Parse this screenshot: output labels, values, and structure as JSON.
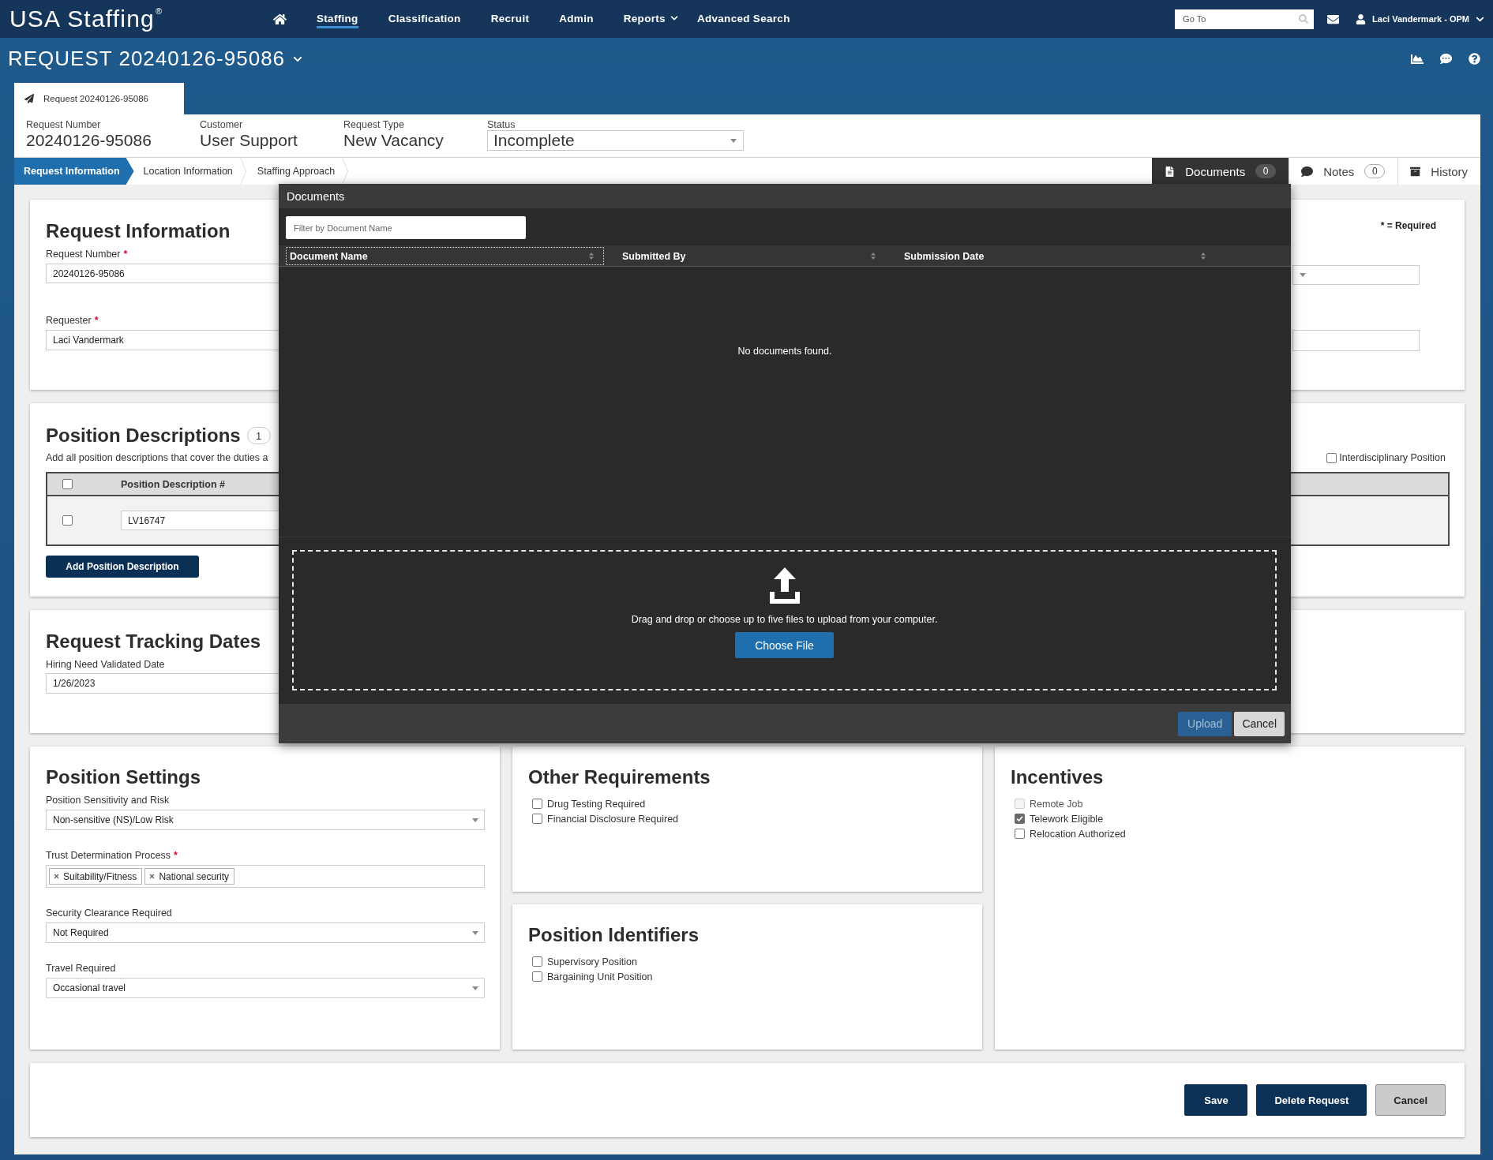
{
  "top_nav": {
    "logo": "USA Staffing$^{®}$",
    "items": [
      {
        "label": "Staffing",
        "selected": true,
        "has_menu": false
      },
      {
        "label": "Classification",
        "selected": false,
        "has_menu": false
      },
      {
        "label": "Recruit",
        "selected": false,
        "has_menu": false
      },
      {
        "label": "Admin",
        "selected": false,
        "has_menu": false
      },
      {
        "label": "Reports",
        "selected": false,
        "has_menu": true
      },
      {
        "label": "Advanced Search",
        "selected": false,
        "has_menu": false
      }
    ],
    "go_to": {
      "placeholder": "Go To"
    },
    "user": "Laci Vandermark - OPM"
  },
  "title_bar": {
    "title": "REQUEST 20240126-95086"
  },
  "record_tab": {
    "label": "Request 20240126-95086"
  },
  "summary": [
    {
      "label": "Request Number",
      "value": "20240126-95086",
      "kind": "text"
    },
    {
      "label": "Customer",
      "value": "User Support",
      "kind": "text"
    },
    {
      "label": "Request Type",
      "value": "New Vacancy",
      "kind": "text"
    },
    {
      "label": "Status",
      "value": "Incomplete",
      "kind": "select"
    }
  ],
  "steps": [
    {
      "label": "Request Information",
      "selected": true
    },
    {
      "label": "Location Information",
      "selected": false
    },
    {
      "label": "Staffing Approach",
      "selected": false
    }
  ],
  "side_tabs": [
    {
      "label": "Documents",
      "count": "0",
      "selected": true
    },
    {
      "label": "Notes",
      "count": "0",
      "selected": false
    },
    {
      "label": "History",
      "selected": false
    }
  ],
  "request_information": {
    "title": "Request Information",
    "required_note": "* = Required",
    "fields": [
      {
        "label": "Request Number",
        "required_mark": "*",
        "value": "20240126-95086"
      },
      {
        "label": "Requester",
        "required_mark": "*",
        "value": "Laci Vandermark"
      }
    ],
    "right_fields": [
      {
        "kind": "select"
      },
      {
        "kind": "text"
      }
    ]
  },
  "position_descriptions": {
    "title": "Position Descriptions",
    "count": "1",
    "description": "Add all position descriptions that cover the duties a",
    "interdisciplinary": {
      "label": "Interdisciplinary Position",
      "checked": false
    },
    "table": {
      "header_checked": false,
      "columns": [
        "Position Description #"
      ],
      "rows": [
        {
          "checked": false,
          "value": "LV16747"
        }
      ]
    },
    "add_button": "Add Position Description"
  },
  "tracking_dates": {
    "title": "Request Tracking Dates",
    "fields": [
      {
        "label": "Hiring Need Validated Date",
        "value": "1/26/2023"
      }
    ]
  },
  "position_settings": {
    "title": "Position Settings",
    "fields": [
      {
        "kind": "select",
        "label": "Position Sensitivity and Risk",
        "value": "Non-sensitive (NS)/Low Risk"
      },
      {
        "kind": "tags",
        "label": "Trust Determination Process",
        "required_mark": "*",
        "tags": [
          "Suitability/Fitness",
          "National security"
        ]
      },
      {
        "kind": "select",
        "label": "Security Clearance Required",
        "value": "Not Required"
      },
      {
        "kind": "select",
        "label": "Travel Required",
        "value": "Occasional travel"
      }
    ]
  },
  "other_requirements": {
    "title": "Other Requirements",
    "options": [
      {
        "label": "Drug Testing Required",
        "checked": false,
        "disabled": false
      },
      {
        "label": "Financial Disclosure Required",
        "checked": false,
        "disabled": false
      }
    ]
  },
  "position_identifiers": {
    "title": "Position Identifiers",
    "options": [
      {
        "label": "Supervisory Position",
        "checked": false,
        "disabled": false
      },
      {
        "label": "Bargaining Unit Position",
        "checked": false,
        "disabled": false
      }
    ]
  },
  "incentives": {
    "title": "Incentives",
    "options": [
      {
        "label": "Remote Job",
        "checked": false,
        "disabled": true
      },
      {
        "label": "Telework Eligible",
        "checked": true,
        "disabled": false
      },
      {
        "label": "Relocation Authorized",
        "checked": false,
        "disabled": false
      }
    ]
  },
  "actions": [
    {
      "label": "Save",
      "kind": "primary"
    },
    {
      "label": "Delete Request",
      "kind": "primary"
    },
    {
      "label": "Cancel",
      "kind": "secondary"
    }
  ],
  "documents_dialog": {
    "title": "Documents",
    "filter": {
      "placeholder": "Filter by Document Name"
    },
    "columns": [
      {
        "label": "Document Name",
        "focused": true
      },
      {
        "label": "Submitted By",
        "focused": false
      },
      {
        "label": "Submission Date",
        "focused": false
      }
    ],
    "empty_message": "No documents found.",
    "drop_zone": {
      "text": "Drag and drop or choose up to five files to upload from your computer.",
      "button": "Choose File"
    },
    "buttons": [
      {
        "label": "Upload",
        "kind": "primary",
        "disabled": true
      },
      {
        "label": "Cancel",
        "kind": "secondary",
        "disabled": false
      }
    ]
  }
}
